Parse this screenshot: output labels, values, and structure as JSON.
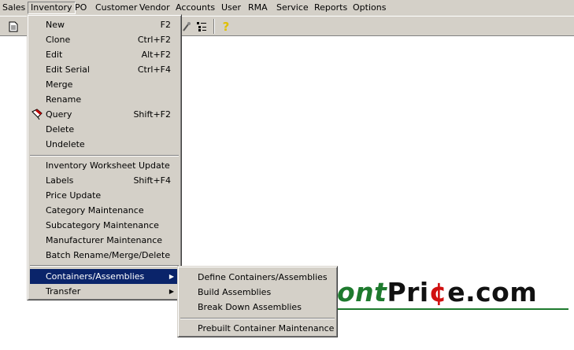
{
  "menubar": {
    "items": [
      "Sales",
      "Inventory",
      "PO",
      "Customer",
      "Vendor",
      "Accounts",
      "User",
      "RMA",
      "Service",
      "Reports",
      "Options"
    ]
  },
  "inventory_menu": {
    "items": [
      {
        "label": "New",
        "shortcut": "F2"
      },
      {
        "label": "Clone",
        "shortcut": "Ctrl+F2"
      },
      {
        "label": "Edit",
        "shortcut": "Alt+F2"
      },
      {
        "label": "Edit Serial",
        "shortcut": "Ctrl+F4"
      },
      {
        "label": "Merge",
        "shortcut": ""
      },
      {
        "label": "Rename",
        "shortcut": ""
      },
      {
        "label": "Query",
        "shortcut": "Shift+F2"
      },
      {
        "label": "Delete",
        "shortcut": ""
      },
      {
        "label": "Undelete",
        "shortcut": ""
      },
      {
        "label": "Inventory Worksheet Update",
        "shortcut": ""
      },
      {
        "label": "Labels",
        "shortcut": "Shift+F4"
      },
      {
        "label": "Price Update",
        "shortcut": ""
      },
      {
        "label": "Category Maintenance",
        "shortcut": ""
      },
      {
        "label": "Subcategory Maintenance",
        "shortcut": ""
      },
      {
        "label": "Manufacturer Maintenance",
        "shortcut": ""
      },
      {
        "label": "Batch Rename/Merge/Delete",
        "shortcut": ""
      },
      {
        "label": "Containers/Assemblies",
        "shortcut": ""
      },
      {
        "label": "Transfer",
        "shortcut": ""
      }
    ]
  },
  "submenu": {
    "items": [
      {
        "label": "Define Containers/Assemblies"
      },
      {
        "label": "Build Assemblies"
      },
      {
        "label": "Break Down Assemblies"
      },
      {
        "label": "Prebuilt Container Maintenance"
      }
    ]
  },
  "toolbar": {
    "help_glyph": "?"
  },
  "logo": {
    "part1": "ont",
    "part2": "Pri",
    "part3": "¢",
    "part4": "e.com"
  },
  "colors": {
    "menu_bg": "#d4d0c8",
    "highlight": "#0a246a",
    "logo_green": "#1e7a2e",
    "logo_red": "#d01010"
  }
}
